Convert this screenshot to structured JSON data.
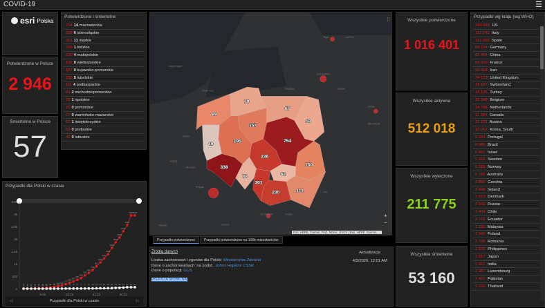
{
  "app": {
    "title": "COVID-19",
    "menu_icon": "hamburger-icon"
  },
  "logo": {
    "brand": "esri",
    "suffix": "Polska"
  },
  "poland_confirmed": {
    "label": "Potwierdzone w Polsce",
    "value": "2 946",
    "color": "#e8141b"
  },
  "poland_deaths": {
    "label": "Śmiertelne w Polsce",
    "value": "57",
    "color": "#dddddd"
  },
  "regions": {
    "title": "Potwierdzone i śmiertelne",
    "items": [
      {
        "c": "754",
        "d": "14",
        "name": "mazowieckie"
      },
      {
        "c": "338",
        "d": "6",
        "name": "dolnośląskie"
      },
      {
        "c": "301",
        "d": "11",
        "name": "śląskie"
      },
      {
        "c": "236",
        "d": "1",
        "name": "łódzkie"
      },
      {
        "c": "230",
        "d": "4",
        "name": "małopolskie"
      },
      {
        "c": "195",
        "d": "8",
        "name": "wielkopolskie"
      },
      {
        "c": "157",
        "d": "0",
        "name": "kujawsko-pomorskie"
      },
      {
        "c": "150",
        "d": "5",
        "name": "lubelskie"
      },
      {
        "c": "111",
        "d": "4",
        "name": "podkarpackie"
      },
      {
        "c": "89",
        "d": "2",
        "name": "zachodniopomorskie"
      },
      {
        "c": "78",
        "d": "1",
        "name": "opolskie"
      },
      {
        "c": "70",
        "d": "0",
        "name": "pomorskie"
      },
      {
        "c": "67",
        "d": "0",
        "name": "warmińsko-mazurskie"
      },
      {
        "c": "62",
        "d": "1",
        "name": "świętokrzyskie"
      },
      {
        "c": "59",
        "d": "0",
        "name": "podlaskie"
      },
      {
        "c": "49",
        "d": "0",
        "name": "lubuskie"
      }
    ]
  },
  "map": {
    "labels": [
      "Copenhagen",
      "Baltic Sea",
      "Berlin",
      "Leipzig",
      "Dresden",
      "Prague",
      "Munich",
      "Vienna",
      "RUSSIA",
      "LITHUANIA",
      "LATVIA",
      "Riga",
      "Vilnius",
      "Minsk",
      "BELARUS",
      "Lviv",
      "SLOVAKIA",
      "Kosice"
    ],
    "attribution": "Esri, HERE, Garmin, FAO, NOAA, USGS | Esri, HERE, Garmin, ...",
    "zoom_in": "+",
    "zoom_out": "−"
  },
  "tabs": [
    {
      "label": "Przypadki potwierdzone",
      "active": true
    },
    {
      "label": "Przypadki potwierdzone na 100k mieszkańców",
      "active": false
    }
  ],
  "sources": {
    "title": "Źródła danych",
    "l1": "Liczba zachorowań i zgonów dla Polski: ",
    "l1_link": "Ministerstwo Zdrowia",
    "l2": "Dane o zachorowaniach: na podst.: ",
    "l2_link": "Johns Hopkins CSSE",
    "l3": "Dane o populacji: ",
    "l3_link": "GUS",
    "mobile": "WERSJA MOBILNA",
    "update_label": "Aktualizacja",
    "update_value": "4/3/2020, 12:01 AM"
  },
  "totals": [
    {
      "label": "Wszystkie potwierdzone",
      "value": "1 016 401",
      "color": "#e8141b"
    },
    {
      "label": "Wszystkie aktywne",
      "value": "512 018",
      "color": "#e9a010"
    },
    {
      "label": "Wszystkie wyleczone",
      "value": "211 775",
      "color": "#8bd11a"
    },
    {
      "label": "Wszystkie śmiertelne",
      "value": "53 160",
      "color": "#dddddd"
    }
  ],
  "countries": {
    "title": "Przypadki wg kraju (wg WHO)",
    "items": [
      {
        "n": "245 559",
        "c": "US"
      },
      {
        "n": "115 242",
        "c": "Italy"
      },
      {
        "n": "112 065",
        "c": "Spain"
      },
      {
        "n": "84 794",
        "c": "Germany"
      },
      {
        "n": "82 464",
        "c": "China"
      },
      {
        "n": "59 929",
        "c": "France"
      },
      {
        "n": "50 468",
        "c": "Iran"
      },
      {
        "n": "34 173",
        "c": "United Kingdom"
      },
      {
        "n": "18 827",
        "c": "Switzerland"
      },
      {
        "n": "18 135",
        "c": "Turkey"
      },
      {
        "n": "15 348",
        "c": "Belgium"
      },
      {
        "n": "14 788",
        "c": "Netherlands"
      },
      {
        "n": "11 284",
        "c": "Canada"
      },
      {
        "n": "11 129",
        "c": "Austria"
      },
      {
        "n": "10 062",
        "c": "Korea, South"
      },
      {
        "n": "9 034",
        "c": "Portugal"
      },
      {
        "n": "8 066",
        "c": "Brazil"
      },
      {
        "n": "6 857",
        "c": "Israel"
      },
      {
        "n": "5 568",
        "c": "Sweden"
      },
      {
        "n": "5 218",
        "c": "Norway"
      },
      {
        "n": "5 116",
        "c": "Australia"
      },
      {
        "n": "3 858",
        "c": "Czechia"
      },
      {
        "n": "3 849",
        "c": "Ireland"
      },
      {
        "n": "3 573",
        "c": "Denmark"
      },
      {
        "n": "3 548",
        "c": "Russia"
      },
      {
        "n": "3 404",
        "c": "Chile"
      },
      {
        "n": "3 163",
        "c": "Ecuador"
      },
      {
        "n": "3 116",
        "c": "Malaysia"
      },
      {
        "n": "2 946",
        "c": "Poland"
      },
      {
        "n": "2 738",
        "c": "Romania"
      },
      {
        "n": "2 633",
        "c": "Philippines"
      },
      {
        "n": "2 617",
        "c": "Japan"
      },
      {
        "n": "2 567",
        "c": "India"
      },
      {
        "n": "2 487",
        "c": "Luxembourg"
      },
      {
        "n": "2 421",
        "c": "Pakistan"
      },
      {
        "n": "2 220",
        "c": "Thailand"
      }
    ]
  },
  "chart_data": {
    "type": "line",
    "title": "Przypadki dla Polski w czasie",
    "footer": "Przypadki dla Polski w czasie",
    "x_ticks": [
      "9.03",
      "16.03",
      "23.03",
      "30.03"
    ],
    "y_ticks": [
      "0",
      "500",
      "1k",
      "1,5k",
      "2k",
      "2,5k",
      "3k",
      "3,5k"
    ],
    "ylim": [
      0,
      3500
    ],
    "series": [
      {
        "name": "Potwierdzone",
        "color": "#d42020",
        "values": [
          1,
          5,
          6,
          11,
          17,
          22,
          31,
          51,
          68,
          104,
          125,
          177,
          238,
          287,
          355,
          425,
          536,
          634,
          749,
          901,
          1051,
          1221,
          1389,
          1638,
          1862,
          2055,
          2311,
          2554,
          2946,
          2946
        ]
      },
      {
        "name": "Śmiertelne",
        "color": "#ffffff",
        "values": [
          0,
          0,
          0,
          0,
          0,
          0,
          0,
          1,
          1,
          3,
          3,
          5,
          5,
          5,
          5,
          7,
          7,
          8,
          10,
          14,
          16,
          16,
          18,
          22,
          31,
          33,
          43,
          57,
          57,
          57
        ]
      }
    ]
  }
}
